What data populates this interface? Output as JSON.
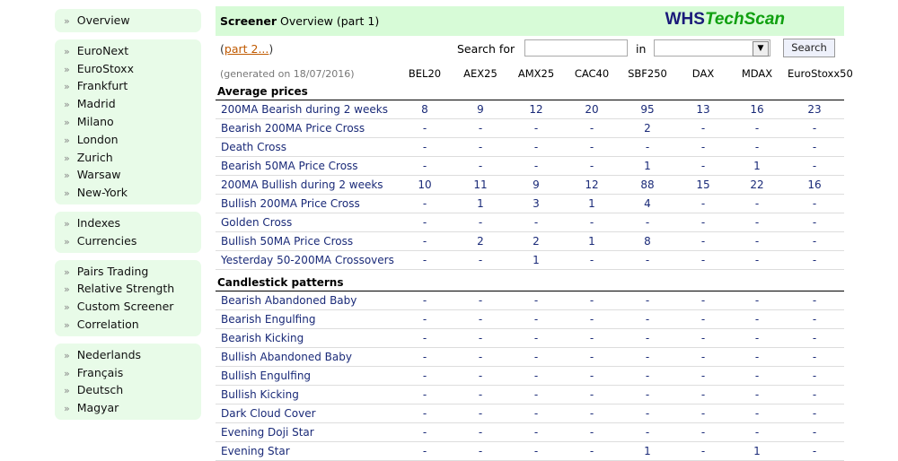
{
  "sidebar": {
    "groups": [
      [
        "Overview"
      ],
      [
        "EuroNext",
        "EuroStoxx",
        "Frankfurt",
        "Madrid",
        "Milano",
        "London",
        "Zurich",
        "Warsaw",
        "New-York"
      ],
      [
        "Indexes",
        "Currencies"
      ],
      [
        "Pairs Trading",
        "Relative Strength",
        "Custom Screener",
        "Correlation"
      ],
      [
        "Nederlands",
        "Français",
        "Deutsch",
        "Magyar"
      ]
    ],
    "arrow": "»"
  },
  "header": {
    "title_bold": "Screener",
    "title_rest": " Overview (part 1)",
    "logo_a": "WHS",
    "logo_b": "TechScan"
  },
  "search": {
    "part2_open": "(",
    "part2_link": "part 2...",
    "part2_close": ")",
    "label": "Search for",
    "in_label": "in",
    "button": "Search",
    "value": "",
    "select_value": ""
  },
  "table": {
    "generated": "(generated on 18/07/2016)",
    "columns": [
      "BEL20",
      "AEX25",
      "AMX25",
      "CAC40",
      "SBF250",
      "DAX",
      "MDAX",
      "EuroStoxx50"
    ],
    "sections": [
      {
        "title": "Average prices",
        "rows": [
          {
            "label": "200MA Bearish during 2 weeks",
            "values": [
              "8",
              "9",
              "12",
              "20",
              "95",
              "13",
              "16",
              "23"
            ]
          },
          {
            "label": "Bearish 200MA Price Cross",
            "values": [
              "-",
              "-",
              "-",
              "-",
              "2",
              "-",
              "-",
              "-"
            ]
          },
          {
            "label": "Death Cross",
            "values": [
              "-",
              "-",
              "-",
              "-",
              "-",
              "-",
              "-",
              "-"
            ]
          },
          {
            "label": "Bearish 50MA Price Cross",
            "values": [
              "-",
              "-",
              "-",
              "-",
              "1",
              "-",
              "1",
              "-"
            ]
          },
          {
            "label": "200MA Bullish during 2 weeks",
            "values": [
              "10",
              "11",
              "9",
              "12",
              "88",
              "15",
              "22",
              "16"
            ]
          },
          {
            "label": "Bullish 200MA Price Cross",
            "values": [
              "-",
              "1",
              "3",
              "1",
              "4",
              "-",
              "-",
              "-"
            ]
          },
          {
            "label": "Golden Cross",
            "values": [
              "-",
              "-",
              "-",
              "-",
              "-",
              "-",
              "-",
              "-"
            ]
          },
          {
            "label": "Bullish 50MA Price Cross",
            "values": [
              "-",
              "2",
              "2",
              "1",
              "8",
              "-",
              "-",
              "-"
            ]
          },
          {
            "label": "Yesterday 50-200MA Crossovers",
            "values": [
              "-",
              "-",
              "1",
              "-",
              "-",
              "-",
              "-",
              "-"
            ]
          }
        ]
      },
      {
        "title": "Candlestick patterns",
        "rows": [
          {
            "label": "Bearish Abandoned Baby",
            "values": [
              "-",
              "-",
              "-",
              "-",
              "-",
              "-",
              "-",
              "-"
            ]
          },
          {
            "label": "Bearish Engulfing",
            "values": [
              "-",
              "-",
              "-",
              "-",
              "-",
              "-",
              "-",
              "-"
            ]
          },
          {
            "label": "Bearish Kicking",
            "values": [
              "-",
              "-",
              "-",
              "-",
              "-",
              "-",
              "-",
              "-"
            ]
          },
          {
            "label": "Bullish Abandoned Baby",
            "values": [
              "-",
              "-",
              "-",
              "-",
              "-",
              "-",
              "-",
              "-"
            ]
          },
          {
            "label": "Bullish Engulfing",
            "values": [
              "-",
              "-",
              "-",
              "-",
              "-",
              "-",
              "-",
              "-"
            ]
          },
          {
            "label": "Bullish Kicking",
            "values": [
              "-",
              "-",
              "-",
              "-",
              "-",
              "-",
              "-",
              "-"
            ]
          },
          {
            "label": "Dark Cloud Cover",
            "values": [
              "-",
              "-",
              "-",
              "-",
              "-",
              "-",
              "-",
              "-"
            ]
          },
          {
            "label": "Evening Doji Star",
            "values": [
              "-",
              "-",
              "-",
              "-",
              "-",
              "-",
              "-",
              "-"
            ]
          },
          {
            "label": "Evening Star",
            "values": [
              "-",
              "-",
              "-",
              "-",
              "1",
              "-",
              "1",
              "-"
            ]
          }
        ]
      }
    ]
  }
}
